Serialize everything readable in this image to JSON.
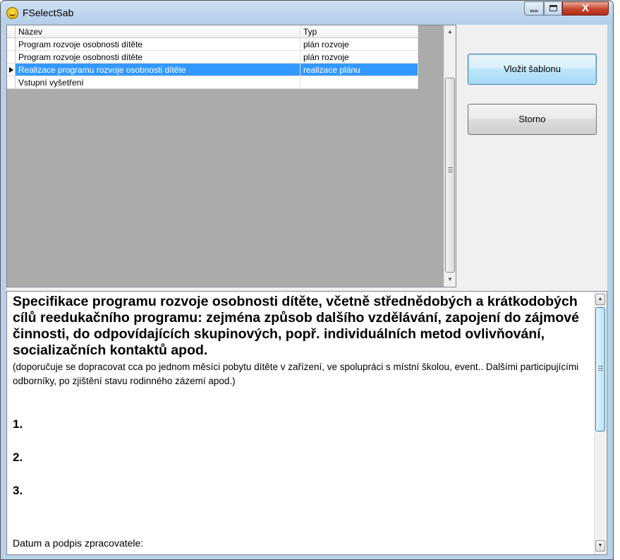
{
  "window": {
    "title": "FSelectSab",
    "close_glyph": "X"
  },
  "grid": {
    "columns": [
      "Název",
      "Typ"
    ],
    "rows": [
      {
        "name": "Program rozvoje osobnosti dítěte",
        "type": "plán rozvoje",
        "selected": false
      },
      {
        "name": "Program rozvoje osobnosti dítěte",
        "type": "plán rozvoje",
        "selected": false
      },
      {
        "name": "Realizace programu rozvoje osobnosti dítěte",
        "type": "realizace plánu",
        "selected": true
      },
      {
        "name": "Vstupní vyšetření",
        "type": "",
        "selected": false
      }
    ]
  },
  "buttons": {
    "insert": "Vložit šablonu",
    "cancel": "Storno"
  },
  "preview": {
    "heading": "Specifikace programu rozvoje osobnosti dítěte, včetně střednědobých a krátkodobých cílů reedukačního programu: zejména způsob dalšího vzdělávání, zapojení do zájmové činnosti, do odpovídajících skupinových, popř. individuálních metod ovlivňování, socializačních kontaktů apod.",
    "note": "(doporučuje se dopracovat cca po jednom měsíci pobytu dítěte v zařízení, ve spolupráci s místní školou, event.. Dalšími participujícími odborníky, po zjištění stavu rodinného zázemí apod.)",
    "items": [
      "1.",
      "2.",
      "3."
    ],
    "signature": "Datum a podpis zpracovatele:"
  },
  "colors": {
    "selection": "#3399ff",
    "frame": "#b9d1ea",
    "close_button": "#c7452c"
  }
}
